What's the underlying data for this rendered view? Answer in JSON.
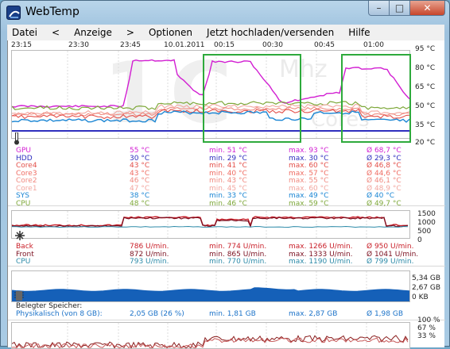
{
  "window": {
    "title": "WebTemp",
    "min_symbol": "–",
    "max_symbol": "□",
    "close_symbol": "✕"
  },
  "menu": {
    "datei": "Datei",
    "back": "<",
    "anzeige": "Anzeige",
    "forward": ">",
    "optionen": "Optionen",
    "upload": "Jetzt hochladen/versenden",
    "hilfe": "Hilfe"
  },
  "time_axis": [
    "23:15",
    "23:30",
    "23:45",
    "10.01.2011",
    "00:15",
    "00:30",
    "00:45",
    "01:00"
  ],
  "temp_axis": [
    "95 °C",
    "80 °C",
    "65 °C",
    "50 °C",
    "35 °C",
    "20 °C"
  ],
  "watermark": {
    "big": "1C",
    "top": "Mhz",
    "bottom": "Cores"
  },
  "temp_rows": [
    {
      "name": "GPU",
      "color": "#d21fd2",
      "cur": "55 °C",
      "min": "min. 51 °C",
      "max": "max. 93 °C",
      "avg": "Ø 68,7 °C"
    },
    {
      "name": "HDD",
      "color": "#2f2fbe",
      "cur": "30 °C",
      "min": "min. 29 °C",
      "max": "max. 30 °C",
      "avg": "Ø 29,3 °C"
    },
    {
      "name": "Core4",
      "color": "#e3504a",
      "cur": "43 °C",
      "min": "min. 41 °C",
      "max": "max. 60 °C",
      "avg": "Ø 46,8 °C"
    },
    {
      "name": "Core3",
      "color": "#ef6d63",
      "cur": "43 °C",
      "min": "min. 40 °C",
      "max": "max. 57 °C",
      "avg": "Ø 44,6 °C"
    },
    {
      "name": "Core2",
      "color": "#f08a80",
      "cur": "46 °C",
      "min": "min. 43 °C",
      "max": "max. 55 °C",
      "avg": "Ø 46,1 °C"
    },
    {
      "name": "Core1",
      "color": "#f2a7a0",
      "cur": "47 °C",
      "min": "min. 45 °C",
      "max": "max. 60 °C",
      "avg": "Ø 48,9 °C"
    },
    {
      "name": "SYS",
      "color": "#1b86d4",
      "cur": "38 °C",
      "min": "min. 33 °C",
      "max": "max. 49 °C",
      "avg": "Ø 40 °C"
    },
    {
      "name": "CPU",
      "color": "#7ea83a",
      "cur": "48 °C",
      "min": "min. 46 °C",
      "max": "max. 59 °C",
      "avg": "Ø 49,7 °C"
    }
  ],
  "fan_axis": [
    "1500",
    "1000",
    "500",
    "0"
  ],
  "fan_rows": [
    {
      "name": "Back",
      "color": "#c9202a",
      "cur": "786 U/min.",
      "min": "min. 774 U/min.",
      "max": "max. 1266 U/min.",
      "avg": "Ø 950 U/min."
    },
    {
      "name": "Front",
      "color": "#7b1020",
      "cur": "872 U/min.",
      "min": "min. 865 U/min.",
      "max": "max. 1333 U/min.",
      "avg": "Ø 1041 U/min."
    },
    {
      "name": "CPU",
      "color": "#2c8aa8",
      "cur": "793 U/min.",
      "min": "min. 770 U/min.",
      "max": "max. 1190 U/min.",
      "avg": "Ø 799 U/min."
    }
  ],
  "mem_axis": [
    "5,34 GB",
    "2,67 GB",
    "0 KB"
  ],
  "mem": {
    "heading": "Belegter Speicher:",
    "label": "Physikalisch (von 8 GB):",
    "cur": "2,05 GB (26 %)",
    "min": "min. 1,81 GB",
    "max": "max. 2,87 GB",
    "avg": "Ø 1,98 GB"
  },
  "cpu_axis": [
    "100 %",
    "67 %",
    "33 %"
  ],
  "colors": {
    "highlight": "#2eaa3c",
    "memory": "#1560b8",
    "menubar": "#f0f0f0"
  }
}
